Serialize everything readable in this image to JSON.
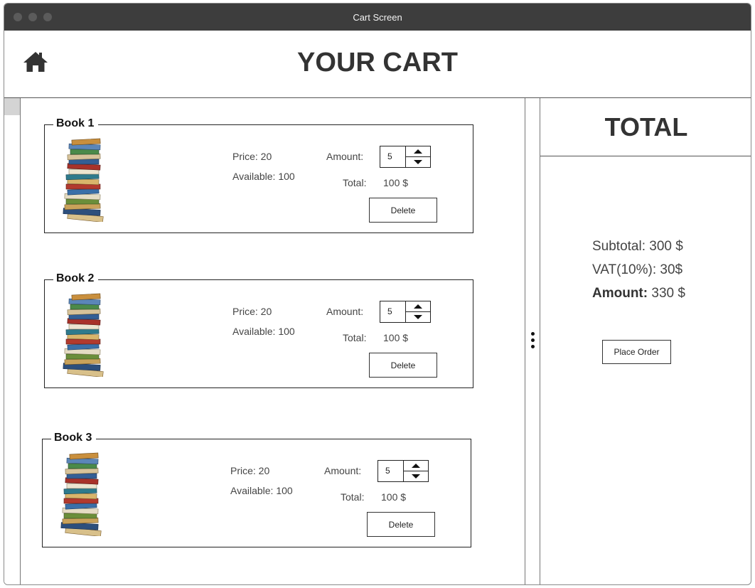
{
  "window": {
    "title": "Cart Screen"
  },
  "header": {
    "title": "YOUR CART",
    "home_icon": "home-icon"
  },
  "books": [
    {
      "name": "Book 1",
      "price_label": "Price: 20",
      "available_label": "Available: 100",
      "amount_label": "Amount:",
      "amount": "5",
      "total_label": "Total:",
      "total_value": "100 $",
      "delete_label": "Delete"
    },
    {
      "name": "Book 2",
      "price_label": "Price: 20",
      "available_label": "Available: 100",
      "amount_label": "Amount:",
      "amount": "5",
      "total_label": "Total:",
      "total_value": "100 $",
      "delete_label": "Delete"
    },
    {
      "name": "Book 3",
      "price_label": "Price: 20",
      "available_label": "Available: 100",
      "amount_label": "Amount:",
      "amount": "5",
      "total_label": "Total:",
      "total_value": "100 $",
      "delete_label": "Delete"
    }
  ],
  "summary": {
    "title": "TOTAL",
    "subtotal": "Subtotal: 300 $",
    "vat": "VAT(10%): 30$",
    "amount_label": "Amount:",
    "amount_value": " 330 $",
    "place_order_label": "Place Order"
  },
  "colors": {
    "titlebar": "#3d3d3d",
    "text": "#333333",
    "border": "#222222"
  }
}
